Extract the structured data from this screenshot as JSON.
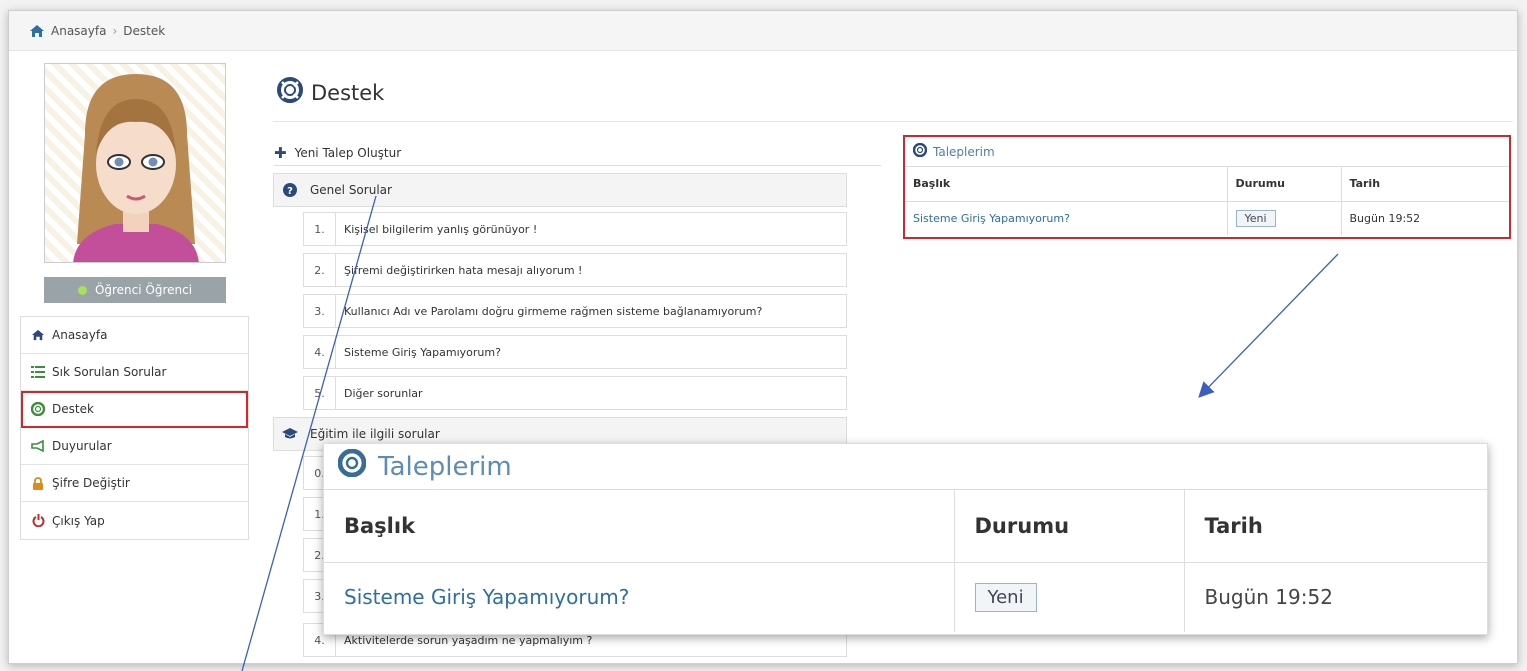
{
  "breadcrumb": {
    "home": "Anasayfa",
    "separator": "›",
    "current": "Destek"
  },
  "user": {
    "name": "Öğrenci Öğrenci",
    "status_color": "#a8e05f"
  },
  "sidebar": {
    "items": [
      {
        "label": "Anasayfa",
        "icon": "home-icon"
      },
      {
        "label": "Sık Sorulan Sorular",
        "icon": "list-icon"
      },
      {
        "label": "Destek",
        "icon": "lifebuoy-icon",
        "active": true
      },
      {
        "label": "Duyurular",
        "icon": "megaphone-icon"
      },
      {
        "label": "Şifre Değiştir",
        "icon": "lock-icon"
      },
      {
        "label": "Çıkış Yap",
        "icon": "power-icon"
      }
    ]
  },
  "page": {
    "title": "Destek",
    "new_request": "Yeni Talep Oluştur"
  },
  "faq": {
    "categories": [
      {
        "title": "Genel Sorular",
        "items": [
          {
            "num": "1.",
            "text": "Kişisel bilgilerim yanlış görünüyor !"
          },
          {
            "num": "2.",
            "text": "Şifremi değiştirirken hata mesajı alıyorum !"
          },
          {
            "num": "3.",
            "text": "Kullanıcı Adı ve Parolamı doğru girmeme rağmen sisteme bağlanamıyorum?"
          },
          {
            "num": "4.",
            "text": "Sisteme Giriş Yapamıyorum?"
          },
          {
            "num": "5.",
            "text": "Diğer sorunlar"
          }
        ]
      },
      {
        "title": "Eğitim ile ilgili sorular",
        "items": [
          {
            "num": "0.",
            "text": ""
          },
          {
            "num": "1.",
            "text": ""
          },
          {
            "num": "2.",
            "text": ""
          },
          {
            "num": "3.",
            "text": ""
          },
          {
            "num": "4.",
            "text": "Aktivitelerde sorun yaşadım ne yapmalıyım ?"
          }
        ]
      }
    ]
  },
  "requests": {
    "title": "Taleplerim",
    "columns": [
      "Başlık",
      "Durumu",
      "Tarih"
    ],
    "rows": [
      {
        "title": "Sisteme Giriş Yapamıyorum?",
        "status": "Yeni",
        "date": "Bugün 19:52"
      }
    ]
  },
  "colors": {
    "accent": "#2d6ea3",
    "highlight": "#d9252a"
  }
}
